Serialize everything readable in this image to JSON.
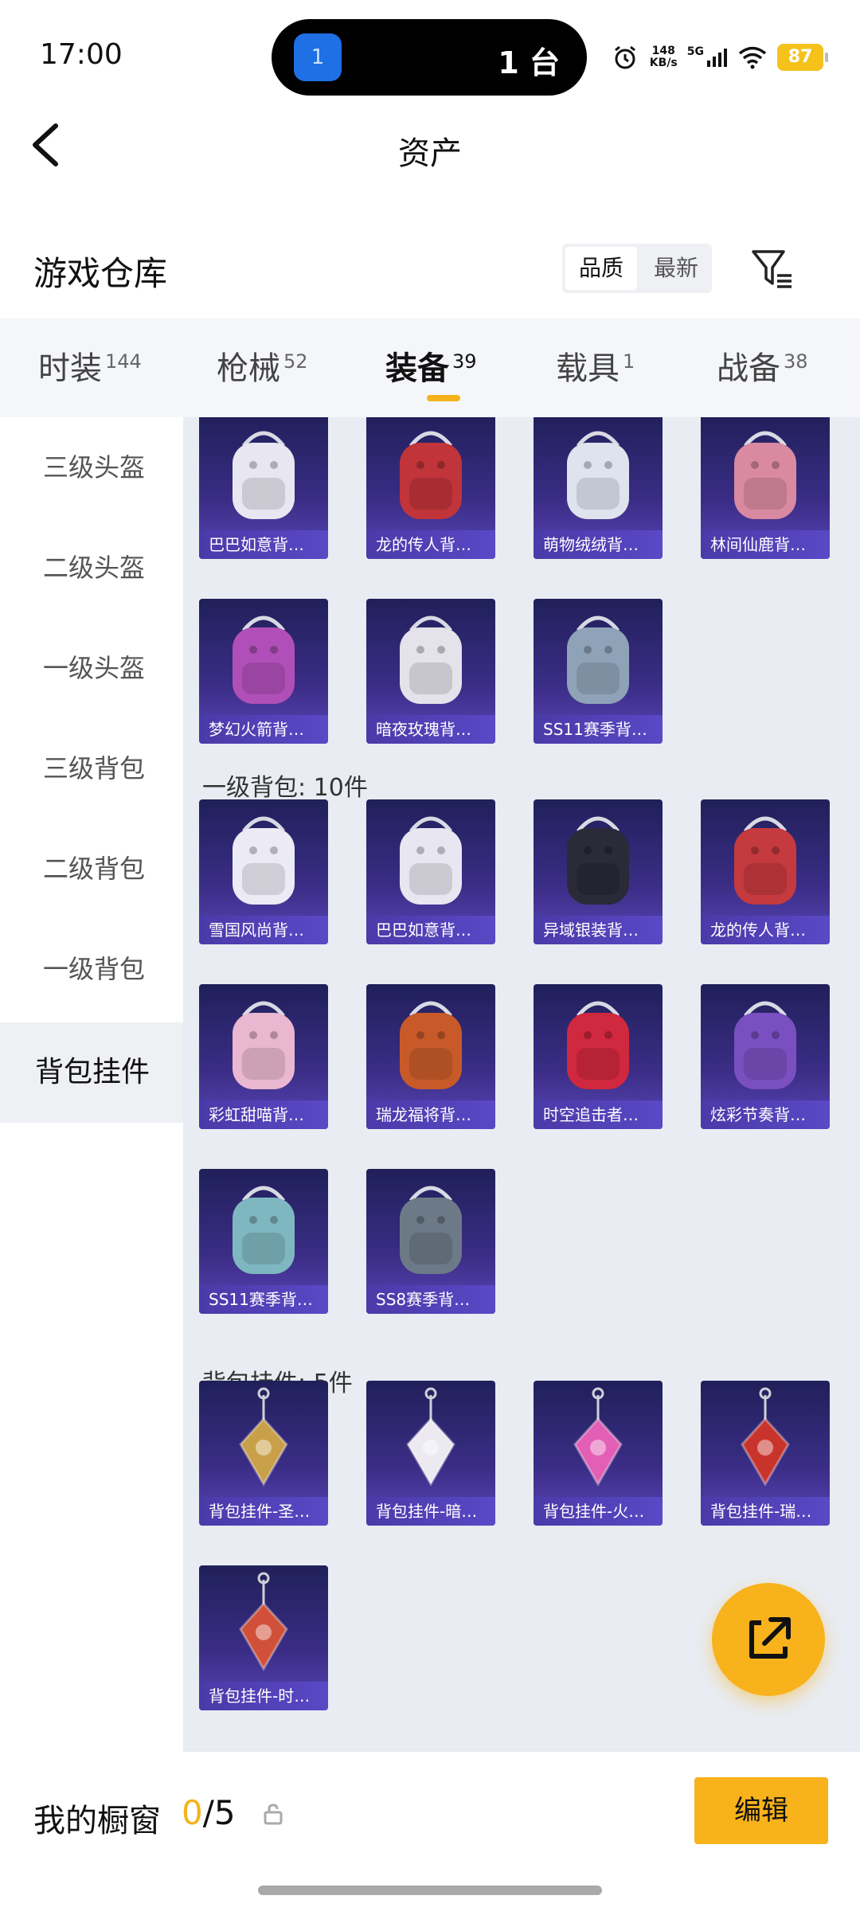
{
  "status": {
    "time": "17:00",
    "island_app_badge": "1",
    "island_text": "1 台",
    "net_speed_value": "148",
    "net_speed_unit": "KB/s",
    "network": "5G",
    "battery": "87"
  },
  "header": {
    "title": "资产"
  },
  "warehouse": {
    "title": "游戏仓库",
    "sort_options": [
      "品质",
      "最新"
    ],
    "active_sort": "品质"
  },
  "tabs": [
    {
      "label": "时装",
      "count": "144"
    },
    {
      "label": "枪械",
      "count": "52"
    },
    {
      "label": "装备",
      "count": "39"
    },
    {
      "label": "载具",
      "count": "1"
    },
    {
      "label": "战备",
      "count": "38"
    }
  ],
  "active_tab": "装备",
  "sidebar": {
    "items": [
      {
        "label": "三级头盔"
      },
      {
        "label": "二级头盔"
      },
      {
        "label": "一级头盔"
      },
      {
        "label": "三级背包"
      },
      {
        "label": "二级背包"
      },
      {
        "label": "一级背包"
      },
      {
        "label": "背包挂件"
      }
    ],
    "active": "背包挂件"
  },
  "sections": {
    "level1_backpack": "一级背包: 10件",
    "backpack_pendant": "背包挂件: 5件"
  },
  "items": [
    {
      "name": "巴巴如意背…",
      "art": "white-rabbit-backpack",
      "color": "#e8e6f0"
    },
    {
      "name": "龙的传人背…",
      "art": "red-backpack",
      "color": "#c0343a"
    },
    {
      "name": "萌物绒绒背…",
      "art": "white-plush-backpack",
      "color": "#dfe3ee"
    },
    {
      "name": "林间仙鹿背…",
      "art": "pink-deer-backpack",
      "color": "#d98aa0"
    },
    {
      "name": "梦幻火箭背…",
      "art": "purple-rocket-backpack",
      "color": "#b04fb8"
    },
    {
      "name": "暗夜玫瑰背…",
      "art": "white-bunny-plush",
      "color": "#e4e2ea"
    },
    {
      "name": "SS11赛季背…",
      "art": "grey-tech-backpack",
      "color": "#8fa3b8"
    },
    {
      "name": "雪国风尚背…",
      "art": "white-snow-backpack",
      "color": "#eceaf4"
    },
    {
      "name": "巴巴如意背…",
      "art": "white-rabbit-backpack",
      "color": "#e8e6f0"
    },
    {
      "name": "异域银装背…",
      "art": "black-harness-backpack",
      "color": "#2a2a38"
    },
    {
      "name": "龙的传人背…",
      "art": "red-dragon-backpack",
      "color": "#c43a3e"
    },
    {
      "name": "彩虹甜喵背…",
      "art": "pastel-cat-backpack",
      "color": "#e9b7cf"
    },
    {
      "name": "瑞龙福将背…",
      "art": "orange-armor-backpack",
      "color": "#c85a2a"
    },
    {
      "name": "时空追击者…",
      "art": "red-chaser-backpack",
      "color": "#d0283e"
    },
    {
      "name": "炫彩节奏背…",
      "art": "purple-graffiti-backpack",
      "color": "#7a4fc0"
    },
    {
      "name": "SS11赛季背…",
      "art": "teal-backpack",
      "color": "#7fb7c0"
    },
    {
      "name": "SS8赛季背…",
      "art": "dark-grey-backpack",
      "color": "#6c7a88"
    },
    {
      "name": "背包挂件-圣…",
      "art": "crystal-pendant",
      "color": "#c9a04a"
    },
    {
      "name": "背包挂件-暗…",
      "art": "bunny-pendant",
      "color": "#eceaf0"
    },
    {
      "name": "背包挂件-火…",
      "art": "pink-rocket-pendant",
      "color": "#e25fb5"
    },
    {
      "name": "背包挂件-瑞…",
      "art": "red-charm-pendant",
      "color": "#c8342c"
    },
    {
      "name": "背包挂件-时…",
      "art": "winged-pendant",
      "color": "#d0503a"
    }
  ],
  "bottom": {
    "showcase_label": "我的橱窗",
    "showcase_current": "0",
    "showcase_total": "/5",
    "edit_label": "编辑"
  }
}
